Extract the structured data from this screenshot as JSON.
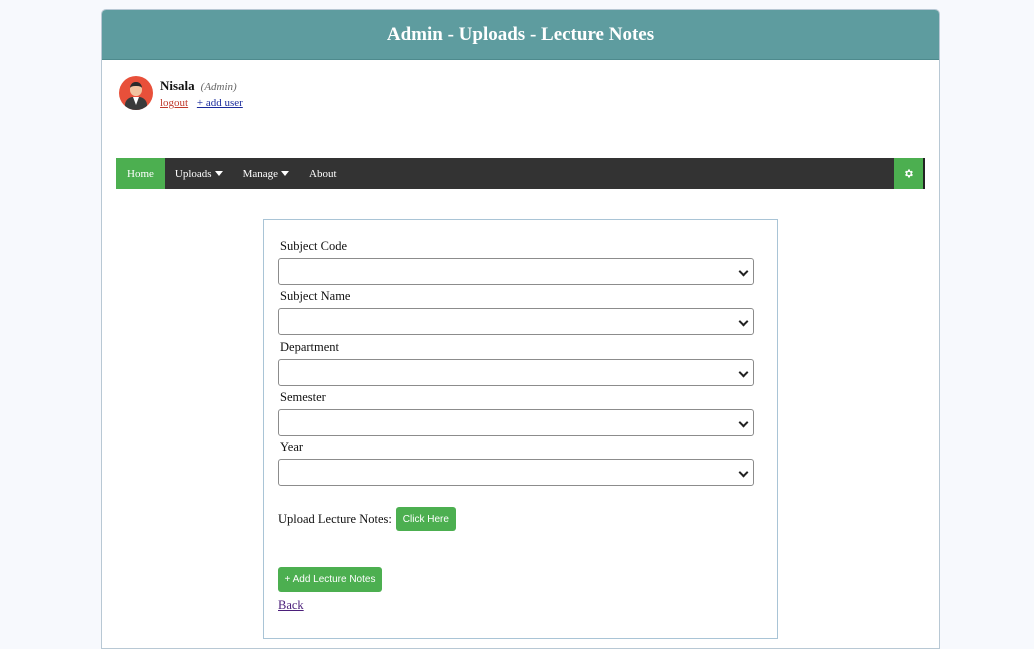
{
  "header": {
    "title": "Admin - Uploads - Lecture Notes"
  },
  "user": {
    "name": "Nisala",
    "role": "(Admin)",
    "logout_label": "logout",
    "add_user_label": "+ add user"
  },
  "nav": {
    "items": [
      {
        "label": "Home",
        "active": true
      },
      {
        "label": "Uploads",
        "dropdown": true
      },
      {
        "label": "Manage",
        "dropdown": true
      },
      {
        "label": "About"
      }
    ],
    "settings_icon": "gear-icon"
  },
  "form": {
    "fields": [
      {
        "label": "Subject Code",
        "value": ""
      },
      {
        "label": "Subject Name",
        "value": ""
      },
      {
        "label": "Department",
        "value": ""
      },
      {
        "label": "Semester",
        "value": ""
      },
      {
        "label": "Year",
        "value": ""
      }
    ],
    "upload_label": "Upload Lecture Notes:",
    "click_here_label": "Click Here",
    "add_button_label": "+ Add Lecture Notes",
    "back_label": "Back"
  },
  "colors": {
    "header_bg": "#5e9c9f",
    "nav_bg": "#333333",
    "accent_green": "#4caf50"
  }
}
